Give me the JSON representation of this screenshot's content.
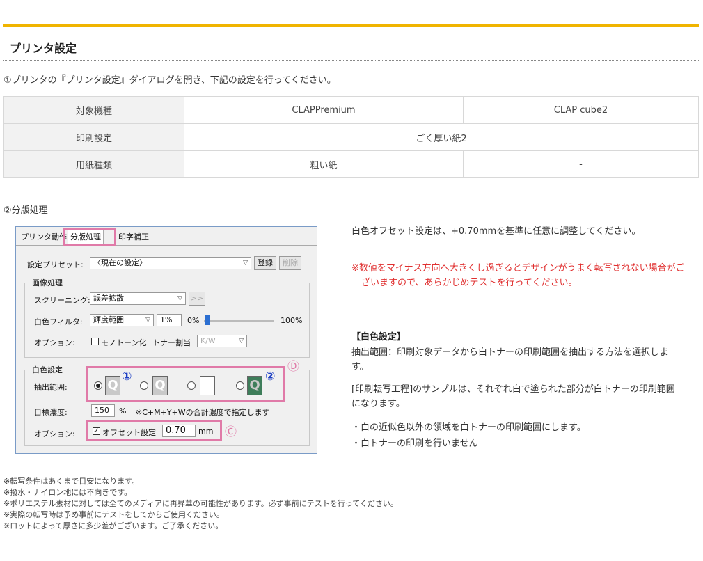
{
  "heading": "プリンタ設定",
  "intro": "①プリンタの『プリンタ設定』ダイアログを開き、下記の設定を行ってください。",
  "table": {
    "rows": [
      {
        "label": "対象機種",
        "c1": "CLAPPremium",
        "c2": "CLAP cube2"
      },
      {
        "label": "印刷設定",
        "merged": "ごく厚い紙2"
      },
      {
        "label": "用紙種類",
        "c1": "粗い紙",
        "c2": "-"
      }
    ]
  },
  "section2": "②分版処理",
  "dialog": {
    "tabs": [
      "プリンタ動作",
      "分版処理",
      "印字補正"
    ],
    "preset_label": "設定プリセット:",
    "preset_value": "〈現在の設定〉",
    "register_btn": "登録",
    "delete_btn": "削除",
    "image_group": "画像処理",
    "screening_label": "スクリーニング:",
    "screening_value": "誤差拡散",
    "screening_btn": ">>",
    "white_filter_label": "白色フィルタ:",
    "white_filter_value": "輝度範囲",
    "white_filter_pct": "1%",
    "slider_min": "0%",
    "slider_max": "100%",
    "option_label": "オプション:",
    "mono_label": "モノトーン化",
    "toner_label": "トナー割当",
    "toner_value": "K/W",
    "white_group": "白色設定",
    "extract_label": "抽出範囲:",
    "marker_1": "①",
    "marker_2": "②",
    "marker_c": "Ⓒ",
    "marker_d": "Ⓓ",
    "density_label": "目標濃度:",
    "density_value": "150",
    "density_unit": "%",
    "density_note": "※C+M+Y+Wの合計濃度で指定します",
    "option2_label": "オプション:",
    "offset_label": "オフセット設定",
    "offset_value": "0.70",
    "offset_unit": "mm"
  },
  "right": {
    "p1": "白色オフセット設定は、+0.70mmを基準に任意に調整してください。",
    "warn": "※数値をマイナス方向へ大きくし過ぎるとデザインがうまく転写されない場合がございますので、あらかじめテストを行ってください。",
    "white_title": "【白色設定】",
    "white_desc": "抽出範囲：印刷対象データから白トナーの印刷範囲を抽出する方法を選択します。",
    "sample_desc": "[印刷転写工程]のサンプルは、それぞれ白で塗られた部分が白トナーの印刷範囲になります。",
    "bullet1": "・白の近似色以外の領域を白トナーの印刷範囲にします。",
    "bullet2": "・白トナーの印刷を行いません"
  },
  "notes": [
    "※転写条件はあくまで目安になります。",
    "※撥水・ナイロン地には不向きです。",
    "※ポリエステル素材に対しては全てのメディアに再昇華の可能性があります。必ず事前にテストを行ってください。",
    "※実際の転写時は予め事前にテストをしてからご使用ください。",
    "※ロットによって厚さに多少差がございます。ご了承ください。"
  ]
}
